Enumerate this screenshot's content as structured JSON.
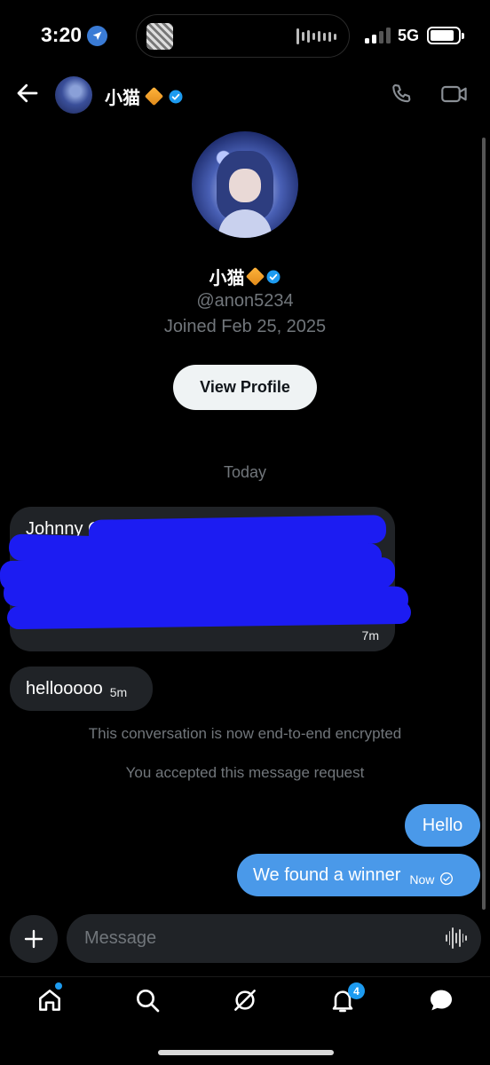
{
  "status_bar": {
    "time": "3:20",
    "network": "5G"
  },
  "header": {
    "contact_name": "小猫",
    "icons": [
      "back-arrow-icon",
      "diamond-badge-icon",
      "verified-badge-icon",
      "phone-icon",
      "video-camera-icon"
    ]
  },
  "profile": {
    "name": "小猫",
    "handle": "@anon5234",
    "joined": "Joined Feb 25, 2025",
    "view_profile_label": "View Profile"
  },
  "conversation": {
    "date_divider": "Today",
    "messages_in": [
      {
        "lines": [
          "Johnny C"
        ],
        "time": "7m",
        "redacted": true
      },
      {
        "text": "hellooooo",
        "time": "5m"
      }
    ],
    "system_notes": [
      "This conversation is now end-to-end encrypted",
      "You accepted this message request"
    ],
    "messages_out": [
      {
        "text": "Hello"
      },
      {
        "text": "We found a winner",
        "time": "Now"
      }
    ]
  },
  "composer": {
    "placeholder": "Message"
  },
  "tab_bar": {
    "items": [
      "home-icon",
      "search-icon",
      "grok-icon",
      "notifications-icon",
      "messages-icon"
    ],
    "notification_count": "4"
  },
  "colors": {
    "background": "#000000",
    "incoming_bubble": "#202327",
    "outgoing_bubble": "#4a99e9",
    "accent": "#1d9bf0",
    "muted_text": "#71767b",
    "redaction": "#1c1cf2"
  }
}
